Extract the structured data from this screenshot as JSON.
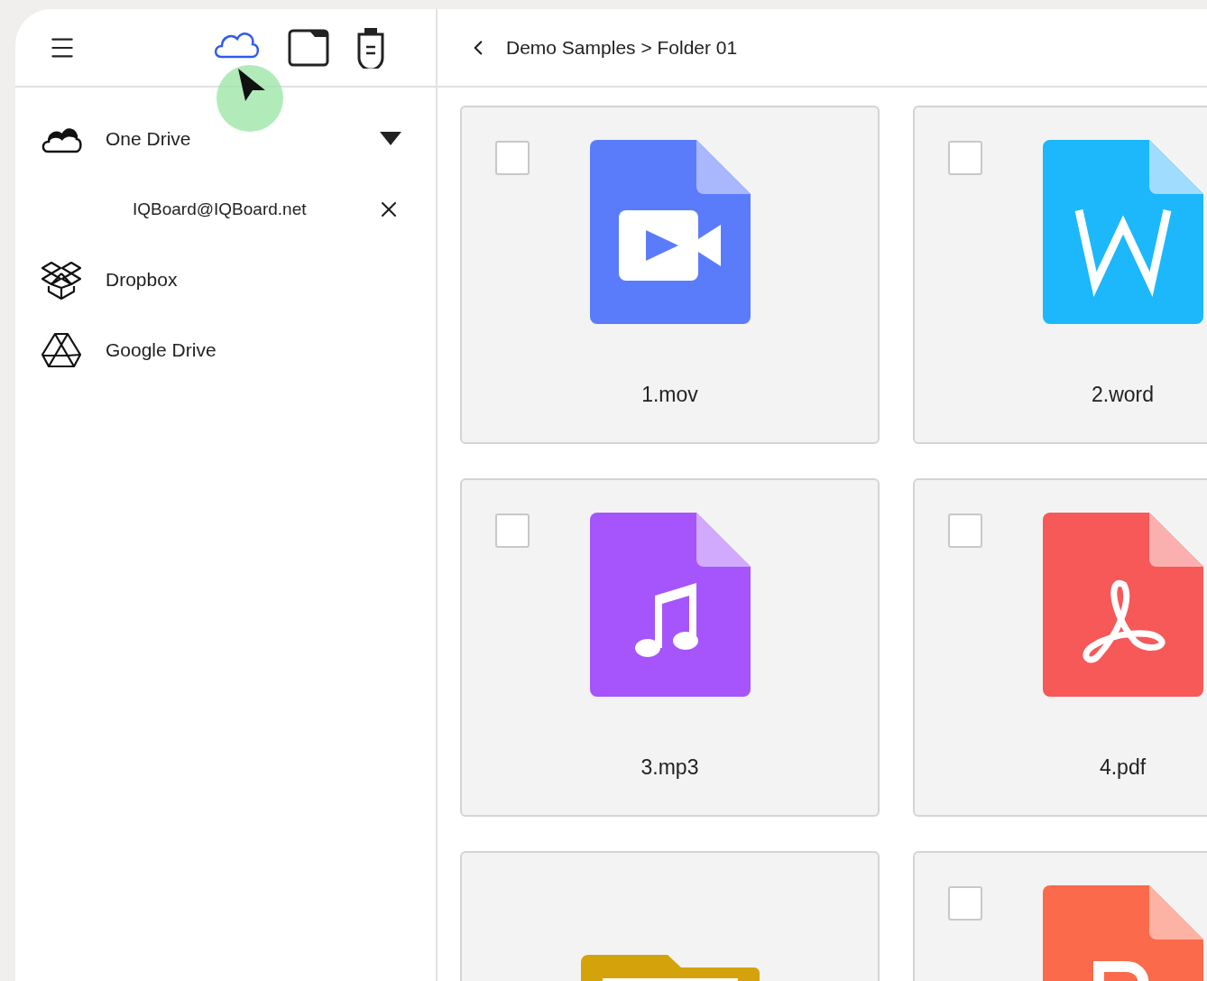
{
  "source_tabs": [
    {
      "kind": "cloud",
      "selected": true
    },
    {
      "kind": "folder",
      "selected": false
    },
    {
      "kind": "usb",
      "selected": false
    }
  ],
  "accounts": [
    {
      "kind": "onedrive",
      "name": "One Drive",
      "expanded": true,
      "children": [
        {
          "email": "IQBoard@IQBoard.net"
        }
      ]
    },
    {
      "kind": "dropbox",
      "name": "Dropbox"
    },
    {
      "kind": "gdrive",
      "name": "Google Drive"
    }
  ],
  "breadcrumb": "Demo Samples > Folder 01",
  "files": [
    {
      "kind": "video",
      "name": "1.mov",
      "checked": false
    },
    {
      "kind": "word",
      "name": "2.word",
      "checked": false
    },
    {
      "kind": "audio",
      "name": "3.mp3",
      "checked": false
    },
    {
      "kind": "pdf",
      "name": "4.pdf",
      "checked": false
    },
    {
      "kind": "folder"
    },
    {
      "kind": "ppt",
      "checked": false
    }
  ]
}
